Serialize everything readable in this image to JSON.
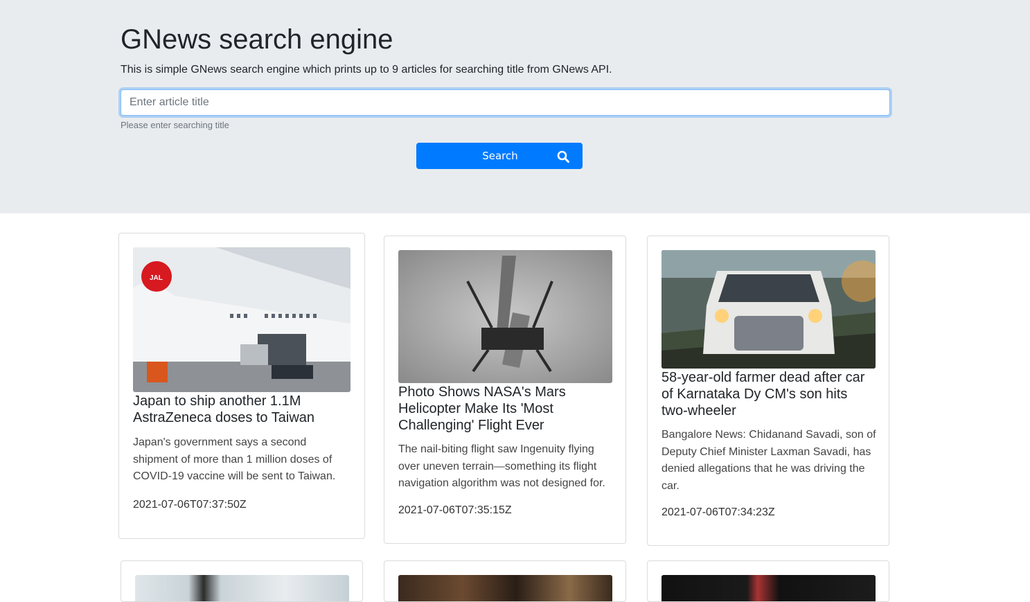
{
  "header": {
    "title": "GNews search engine",
    "lead": "This is simple GNews search engine which prints up to 9 articles for searching title from GNews API."
  },
  "search": {
    "placeholder": "Enter article title",
    "value": "",
    "help": "Please enter searching title",
    "button_label": "Search",
    "button_icon": "search-icon"
  },
  "colors": {
    "primary": "#007bff",
    "jumbotron": "#e9ecef"
  },
  "articles": [
    {
      "image": "airplane-cargo-photo",
      "title": "Japan to ship another 1.1M AstraZeneca doses to Taiwan",
      "description": "Japan's government says a second shipment of more than 1 million doses of COVID-19 vaccine will be sent to Taiwan.",
      "published": "2021-07-06T07:37:50Z"
    },
    {
      "image": "mars-helicopter-shadow-photo",
      "title": "Photo Shows NASA's Mars Helicopter Make Its 'Most Challenging' Flight Ever",
      "description": "The nail-biting flight saw Ingenuity flying over uneven terrain—something its flight navigation algorithm was not designed for.",
      "published": "2021-07-06T07:35:15Z"
    },
    {
      "image": "white-suv-photo",
      "title": "58-year-old farmer dead after car of Karnataka Dy CM's son hits two-wheeler",
      "description": "Bangalore News: Chidanand Savadi, son of Deputy Chief Minister Laxman Savadi, has denied allegations that he was driving the car.",
      "published": "2021-07-06T07:34:23Z"
    }
  ]
}
